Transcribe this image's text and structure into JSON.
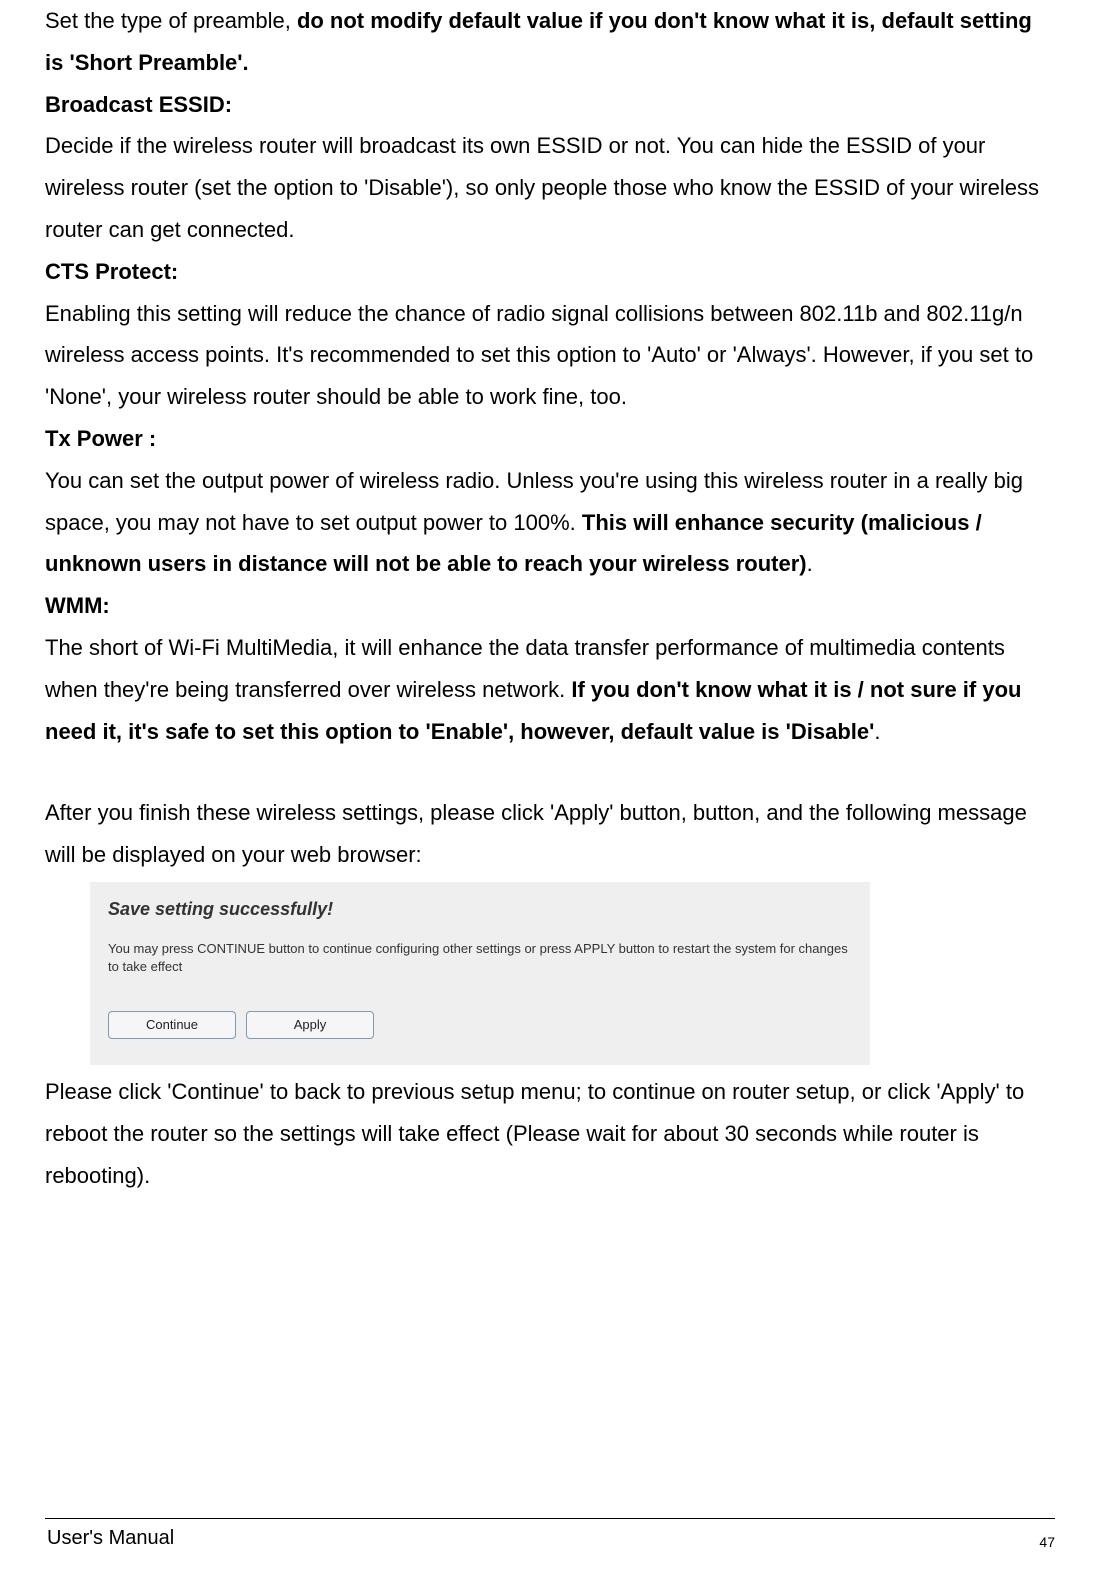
{
  "body": {
    "preamble_intro": "Set the type of preamble, ",
    "preamble_bold": "do not modify default value if you don't know what it is, default setting is 'Short Preamble'.",
    "broadcast_heading": "Broadcast ESSID:",
    "broadcast_body": "Decide if the wireless router will broadcast its own ESSID or not. You can hide the ESSID of your wireless router (set the option to 'Disable'), so only people those who know the ESSID of your wireless router can get connected.",
    "cts_heading": "CTS Protect:",
    "cts_body": "Enabling this setting will reduce the chance of radio signal collisions between 802.11b and 802.11g/n wireless access points. It's recommended to set this option to 'Auto' or 'Always'. However, if you set to 'None', your wireless router should be able to work fine, too.",
    "tx_heading": "Tx Power :",
    "tx_body_a": "You can set the output power of wireless radio. Unless you're using this wireless router in a really big space, you may not have to set output power to 100%. ",
    "tx_body_bold": "This will enhance security (malicious / unknown users in distance will not be able to reach your wireless router)",
    "tx_body_end": ".",
    "wmm_heading": "WMM:",
    "wmm_body_a": "The short of Wi-Fi MultiMedia, it will enhance the data transfer performance of multimedia contents when they're being transferred over wireless network. ",
    "wmm_body_bold": "If you don't know what it is / not sure if you need it, it's safe to set this option to 'Enable', however, default value is 'Disable'",
    "wmm_body_end": ".",
    "after_finish": "After you finish these wireless settings, please click 'Apply' button, button, and the following message will be displayed on your web browser:",
    "closing": "Please click 'Continue' to back to previous setup menu; to continue on router setup, or click 'Apply' to reboot the router so the settings will take effect (Please wait for about 30 seconds while router is rebooting)."
  },
  "screenshot": {
    "title": "Save setting successfully!",
    "desc": "You may press CONTINUE button to continue configuring other settings or press APPLY button to restart the system for changes to take effect",
    "continue_label": "Continue",
    "apply_label": "Apply"
  },
  "footer": {
    "left": "User's Manual",
    "page": "47"
  }
}
